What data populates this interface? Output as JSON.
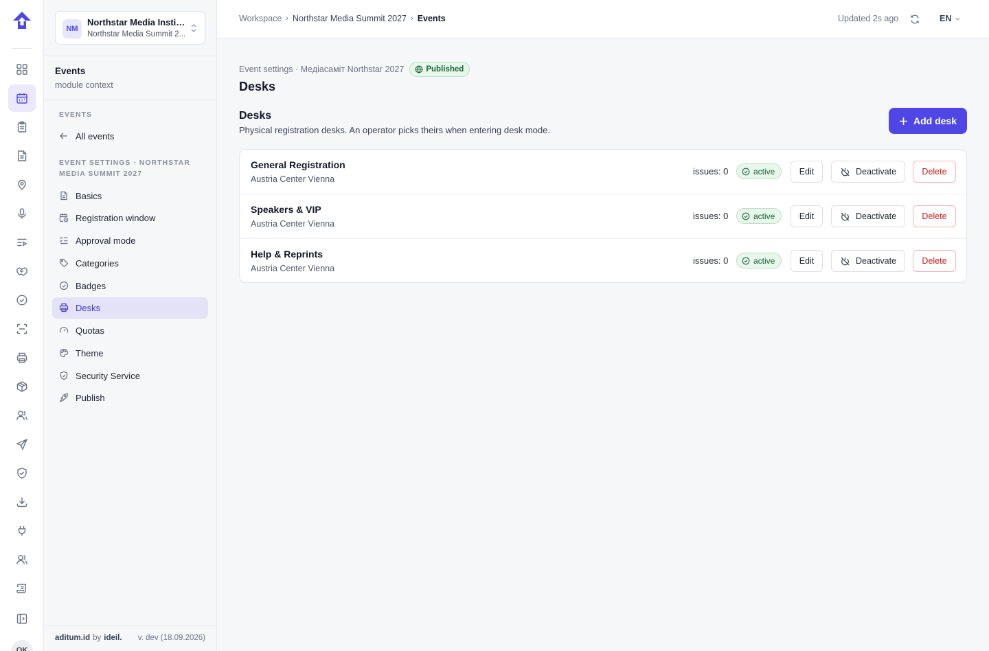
{
  "rail": {
    "items": [
      {
        "icon": "dashboard-icon"
      },
      {
        "icon": "calendar-icon",
        "active": true
      },
      {
        "icon": "clipboard-icon"
      },
      {
        "icon": "document-icon"
      },
      {
        "icon": "map-pin-icon"
      },
      {
        "icon": "microphone-icon"
      },
      {
        "icon": "list-play-icon"
      },
      {
        "icon": "handshake-icon"
      },
      {
        "icon": "check-circle-icon"
      },
      {
        "icon": "scan-icon"
      },
      {
        "icon": "printer-icon"
      },
      {
        "icon": "box-icon"
      },
      {
        "icon": "users-icon"
      },
      {
        "icon": "send-icon"
      },
      {
        "icon": "shield-check-icon"
      },
      {
        "icon": "download-icon"
      },
      {
        "icon": "plug-icon"
      },
      {
        "icon": "user-group-icon"
      },
      {
        "icon": "scroll-icon"
      },
      {
        "icon": "panel-toggle-icon"
      }
    ],
    "user_initials": "OK"
  },
  "org": {
    "initials": "NM",
    "name": "Northstar Media Instit...",
    "event": "Northstar Media Summit 2..."
  },
  "module": {
    "title": "Events",
    "subtitle": "module context"
  },
  "nav": {
    "events_label": "EVENTS",
    "all_events": "All events",
    "settings_label_1": "EVENT SETTINGS · NORTHSTAR",
    "settings_label_2": "MEDIA SUMMIT 2027",
    "items": [
      {
        "label": "Basics",
        "icon": "file-icon"
      },
      {
        "label": "Registration window",
        "icon": "calendar-clock-icon"
      },
      {
        "label": "Approval mode",
        "icon": "list-check-icon"
      },
      {
        "label": "Categories",
        "icon": "tag-icon"
      },
      {
        "label": "Badges",
        "icon": "badge-icon"
      },
      {
        "label": "Desks",
        "icon": "printer-icon",
        "active": true
      },
      {
        "label": "Quotas",
        "icon": "gauge-icon"
      },
      {
        "label": "Theme",
        "icon": "palette-icon"
      },
      {
        "label": "Security Service",
        "icon": "shield-icon"
      },
      {
        "label": "Publish",
        "icon": "rocket-icon"
      }
    ]
  },
  "footer": {
    "brand": "aditum.id",
    "by": "by",
    "maker": "ideil.",
    "version": "v. dev (18.09.2026)"
  },
  "topbar": {
    "crumb1": "Workspace",
    "crumb2": "Northstar Media Summit 2027",
    "crumb3": "Events",
    "updated": "Updated 2s ago",
    "lang": "EN"
  },
  "main": {
    "context": "Event settings · Медіасаміт Northstar 2027",
    "status": "Published",
    "page_title": "Desks",
    "section_title": "Desks",
    "section_desc": "Physical registration desks. An operator picks theirs when entering desk mode.",
    "add_button": "Add desk"
  },
  "desks": [
    {
      "name": "General Registration",
      "location": "Austria Center Vienna",
      "issues": "issues: 0",
      "status": "active",
      "edit": "Edit",
      "deactivate": "Deactivate",
      "delete": "Delete"
    },
    {
      "name": "Speakers & VIP",
      "location": "Austria Center Vienna",
      "issues": "issues: 0",
      "status": "active",
      "edit": "Edit",
      "deactivate": "Deactivate",
      "delete": "Delete"
    },
    {
      "name": "Help & Reprints",
      "location": "Austria Center Vienna",
      "issues": "issues: 0",
      "status": "active",
      "edit": "Edit",
      "deactivate": "Deactivate",
      "delete": "Delete"
    }
  ],
  "colors": {
    "accent": "#4f46e5",
    "success": "#166534",
    "danger": "#c81e1e"
  }
}
